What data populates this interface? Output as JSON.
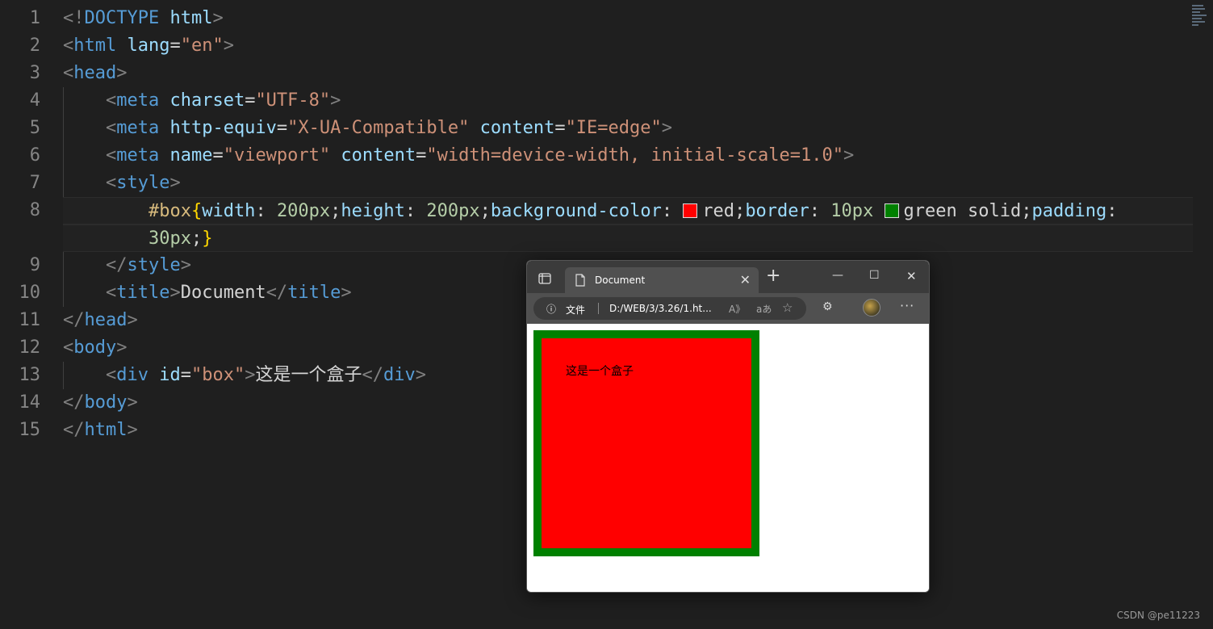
{
  "editor": {
    "line_numbers": [
      "1",
      "2",
      "3",
      "4",
      "5",
      "6",
      "7",
      "8",
      "",
      "9",
      "10",
      "11",
      "12",
      "13",
      "14",
      "15"
    ],
    "l1": {
      "open": "<!",
      "kw": "DOCTYPE",
      "sp": " ",
      "tag": "html",
      "close": ">"
    },
    "l2": {
      "open": "<",
      "tag": "html",
      "attr": "lang",
      "eq": "=",
      "val": "\"en\"",
      "close": ">"
    },
    "l3": {
      "open": "<",
      "tag": "head",
      "close": ">"
    },
    "l4": {
      "open": "<",
      "tag": "meta",
      "attr": "charset",
      "eq": "=",
      "val": "\"UTF-8\"",
      "close": ">"
    },
    "l5": {
      "open": "<",
      "tag": "meta",
      "attr1": "http-equiv",
      "eq1": "=",
      "val1": "\"X-UA-Compatible\"",
      "attr2": "content",
      "eq2": "=",
      "val2": "\"IE=edge\"",
      "close": ">"
    },
    "l6": {
      "open": "<",
      "tag": "meta",
      "attr1": "name",
      "eq1": "=",
      "val1": "\"viewport\"",
      "attr2": "content",
      "eq2": "=",
      "val2": "\"width=device-width, initial-scale=1.0\"",
      "close": ">"
    },
    "l7": {
      "open": "<",
      "tag": "style",
      "close": ">"
    },
    "l8": {
      "sel": "#box",
      "brace_open": "{",
      "p1": "width",
      "c1": ": ",
      "v1": "200px",
      "s1": ";",
      "p2": "height",
      "c2": ": ",
      "v2": "200px",
      "s2": ";",
      "p3": "background-color",
      "c3": ": ",
      "v3": "red",
      "s3": ";",
      "p4": "border",
      "c4": ": ",
      "v4": "10px",
      "v4b": "green solid",
      "s4": ";",
      "p5": "padding",
      "c5": ":"
    },
    "l8b": {
      "v5": "30px",
      "s5": ";",
      "brace_close": "}"
    },
    "l9": {
      "open": "</",
      "tag": "style",
      "close": ">"
    },
    "l10": {
      "open": "<",
      "tag": "title",
      "close": ">",
      "text": "Document",
      "open2": "</",
      "tag2": "title",
      "close2": ">"
    },
    "l11": {
      "open": "</",
      "tag": "head",
      "close": ">"
    },
    "l12": {
      "open": "<",
      "tag": "body",
      "close": ">"
    },
    "l13": {
      "open": "<",
      "tag": "div",
      "attr": "id",
      "eq": "=",
      "val": "\"box\"",
      "close": ">",
      "text": "这是一个盒子",
      "open2": "</",
      "tag2": "div",
      "close2": ">"
    },
    "l14": {
      "open": "</",
      "tag": "body",
      "close": ">"
    },
    "l15": {
      "open": "</",
      "tag": "html",
      "close": ">"
    },
    "colors": {
      "red_swatch": "#ff0000",
      "green_swatch": "#008000"
    }
  },
  "browser": {
    "tab_title": "Document",
    "tab_close": "✕",
    "new_tab": "+",
    "minimize": "—",
    "maximize": "☐",
    "close": "✕",
    "address_info_icon": "ⓘ",
    "address_label": "文件",
    "url": "D:/WEB/3/3.26/1.ht...",
    "read_aloud_icon": "A》",
    "translate_icon": "aあ",
    "favorite_icon": "☆",
    "extensions_icon": "⚙",
    "more": "···",
    "box_text": "这是一个盒子"
  },
  "watermark": "CSDN @pe11223"
}
